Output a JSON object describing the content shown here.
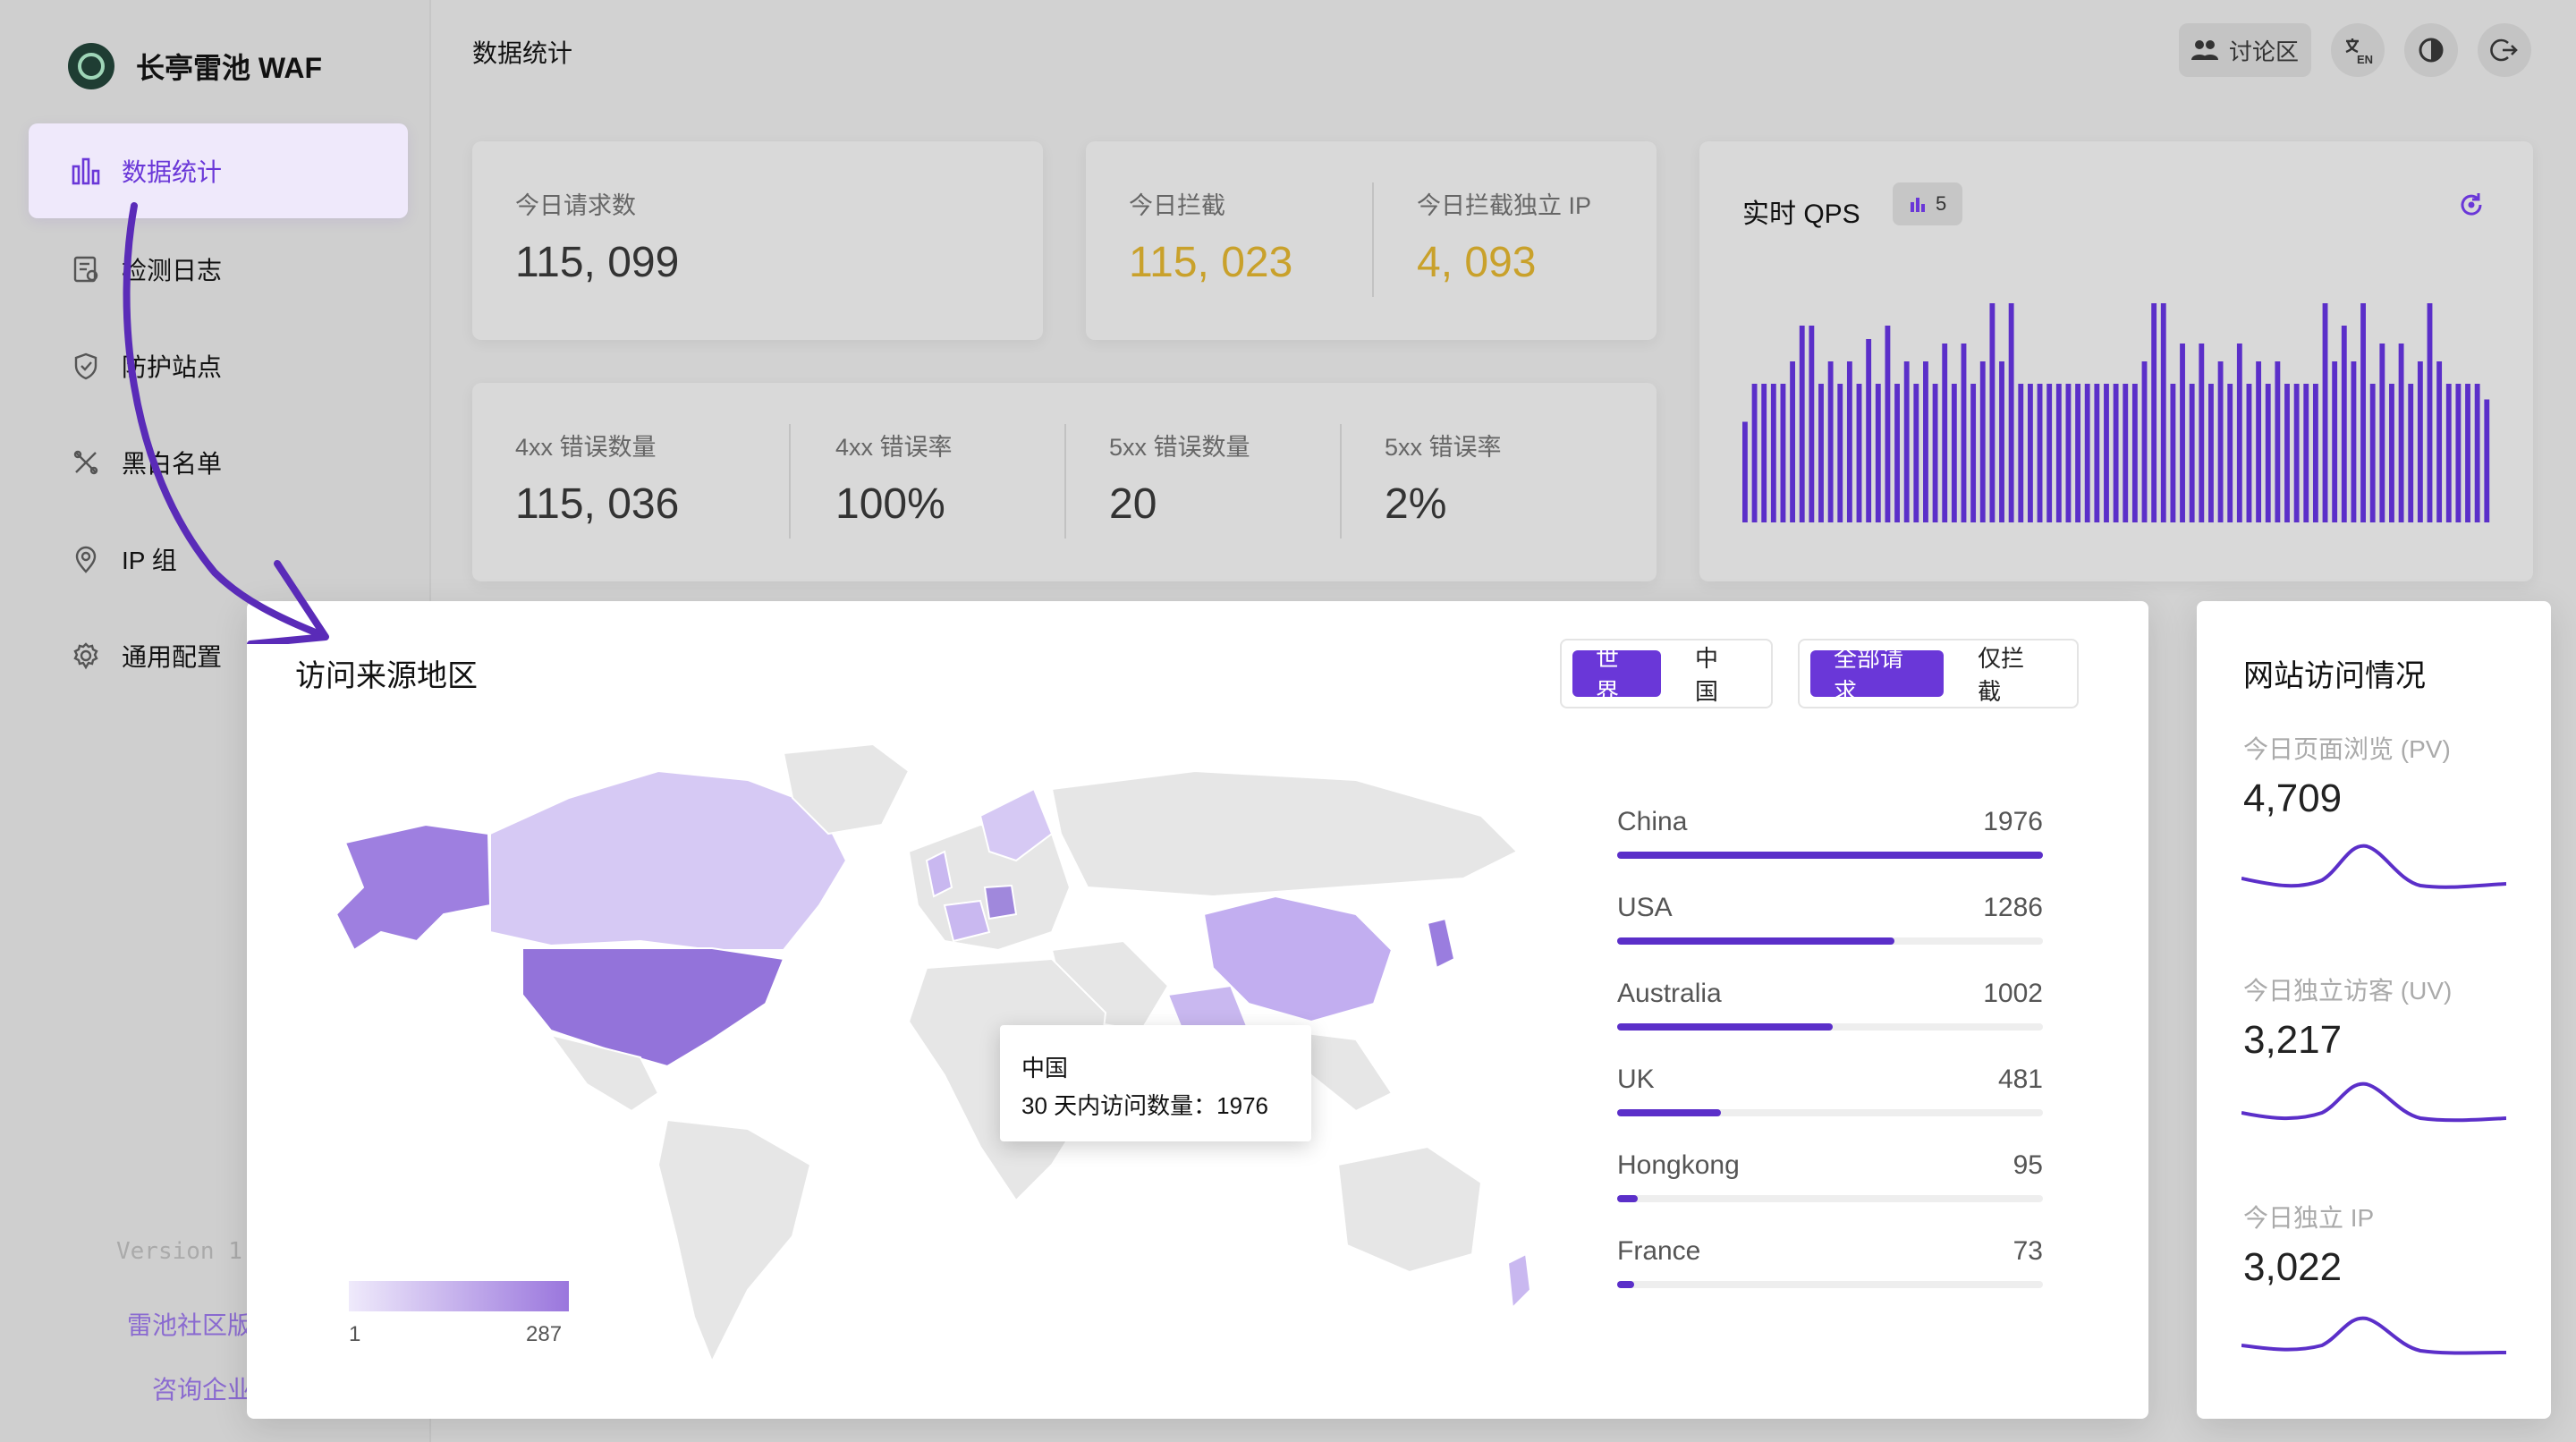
{
  "brand": {
    "name": "长亭雷池 WAF"
  },
  "sidebar": {
    "items": [
      {
        "label": "数据统计",
        "icon": "bar-chart-icon",
        "active": true
      },
      {
        "label": "检测日志",
        "icon": "log-icon"
      },
      {
        "label": "防护站点",
        "icon": "shield-icon"
      },
      {
        "label": "黑白名单",
        "icon": "tools-icon"
      },
      {
        "label": "IP 组",
        "icon": "ip-pin-icon"
      },
      {
        "label": "通用配置",
        "icon": "gear-icon"
      }
    ],
    "version": "Version 1",
    "link1": "雷池社区版",
    "link2": "咨询企业"
  },
  "header": {
    "title": "数据统计",
    "discuss_label": "讨论区"
  },
  "stats": {
    "today_requests_label": "今日请求数",
    "today_requests": "115, 099",
    "today_blocked_label": "今日拦截",
    "today_blocked": "115, 023",
    "today_blocked_ip_label": "今日拦截独立 IP",
    "today_blocked_ip": "4, 093",
    "err4xx_count_label": "4xx 错误数量",
    "err4xx_count": "115, 036",
    "err4xx_rate_label": "4xx 错误率",
    "err4xx_rate": "100%",
    "err5xx_count_label": "5xx 错误数量",
    "err5xx_count": "20",
    "err5xx_rate_label": "5xx 错误率",
    "err5xx_rate": "2%"
  },
  "qps": {
    "title": "实时 QPS",
    "badge": "5",
    "accent": "#5b2fc9"
  },
  "region": {
    "title": "访问来源地区",
    "scope_options": [
      "世界",
      "中国"
    ],
    "scope_selected": "世界",
    "filter_options": [
      "全部请求",
      "仅拦截"
    ],
    "filter_selected": "全部请求",
    "legend_min": "1",
    "legend_max": "287",
    "tooltip_title": "中国",
    "tooltip_text": "30 天内访问数量：1976",
    "ranking": [
      {
        "name": "China",
        "count": "1976",
        "value": 1976
      },
      {
        "name": "USA",
        "count": "1286",
        "value": 1286
      },
      {
        "name": "Australia",
        "count": "1002",
        "value": 1002
      },
      {
        "name": "UK",
        "count": "481",
        "value": 481
      },
      {
        "name": "Hongkong",
        "count": "95",
        "value": 95
      },
      {
        "name": "France",
        "count": "73",
        "value": 73
      }
    ]
  },
  "site": {
    "title": "网站访问情况",
    "pv_label": "今日页面浏览 (PV)",
    "pv_value": "4,709",
    "uv_label": "今日独立访客 (UV)",
    "uv_value": "3,217",
    "ip_label": "今日独立 IP",
    "ip_value": "3,022"
  },
  "colors": {
    "accent": "#6a37d8",
    "gold": "#c9a12b"
  }
}
